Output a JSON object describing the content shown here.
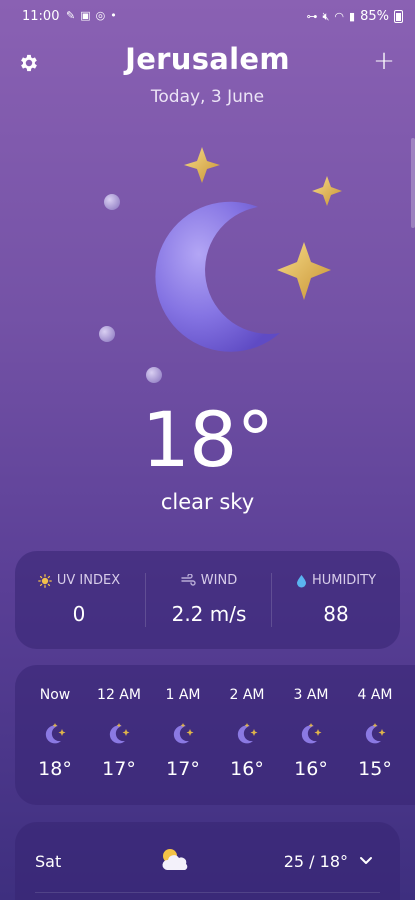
{
  "status_bar": {
    "time": "11:00",
    "battery": "85%"
  },
  "header": {
    "city": "Jerusalem",
    "date": "Today, 3 June"
  },
  "current": {
    "temperature": "18°",
    "condition": "clear sky"
  },
  "stats": [
    {
      "label": "UV INDEX",
      "value": "0",
      "icon": "sun-icon"
    },
    {
      "label": "WIND",
      "value": "2.2 m/s",
      "icon": "wind-icon"
    },
    {
      "label": "HUMIDITY",
      "value": "88",
      "icon": "droplet-icon"
    }
  ],
  "hourly": [
    {
      "time": "Now",
      "temp": "18°",
      "icon": "moon-stars-icon"
    },
    {
      "time": "12 AM",
      "temp": "17°",
      "icon": "moon-stars-icon"
    },
    {
      "time": "1 AM",
      "temp": "17°",
      "icon": "moon-stars-icon"
    },
    {
      "time": "2 AM",
      "temp": "16°",
      "icon": "moon-stars-icon"
    },
    {
      "time": "3 AM",
      "temp": "16°",
      "icon": "moon-stars-icon"
    },
    {
      "time": "4 AM",
      "temp": "15°",
      "icon": "moon-stars-icon"
    }
  ],
  "daily": [
    {
      "day": "Sat",
      "range": "25 / 18°",
      "icon": "sun-cloud-icon"
    }
  ],
  "colors": {
    "moon": "#8d7ae6",
    "star": "#e0b54a",
    "card": "#372473"
  }
}
